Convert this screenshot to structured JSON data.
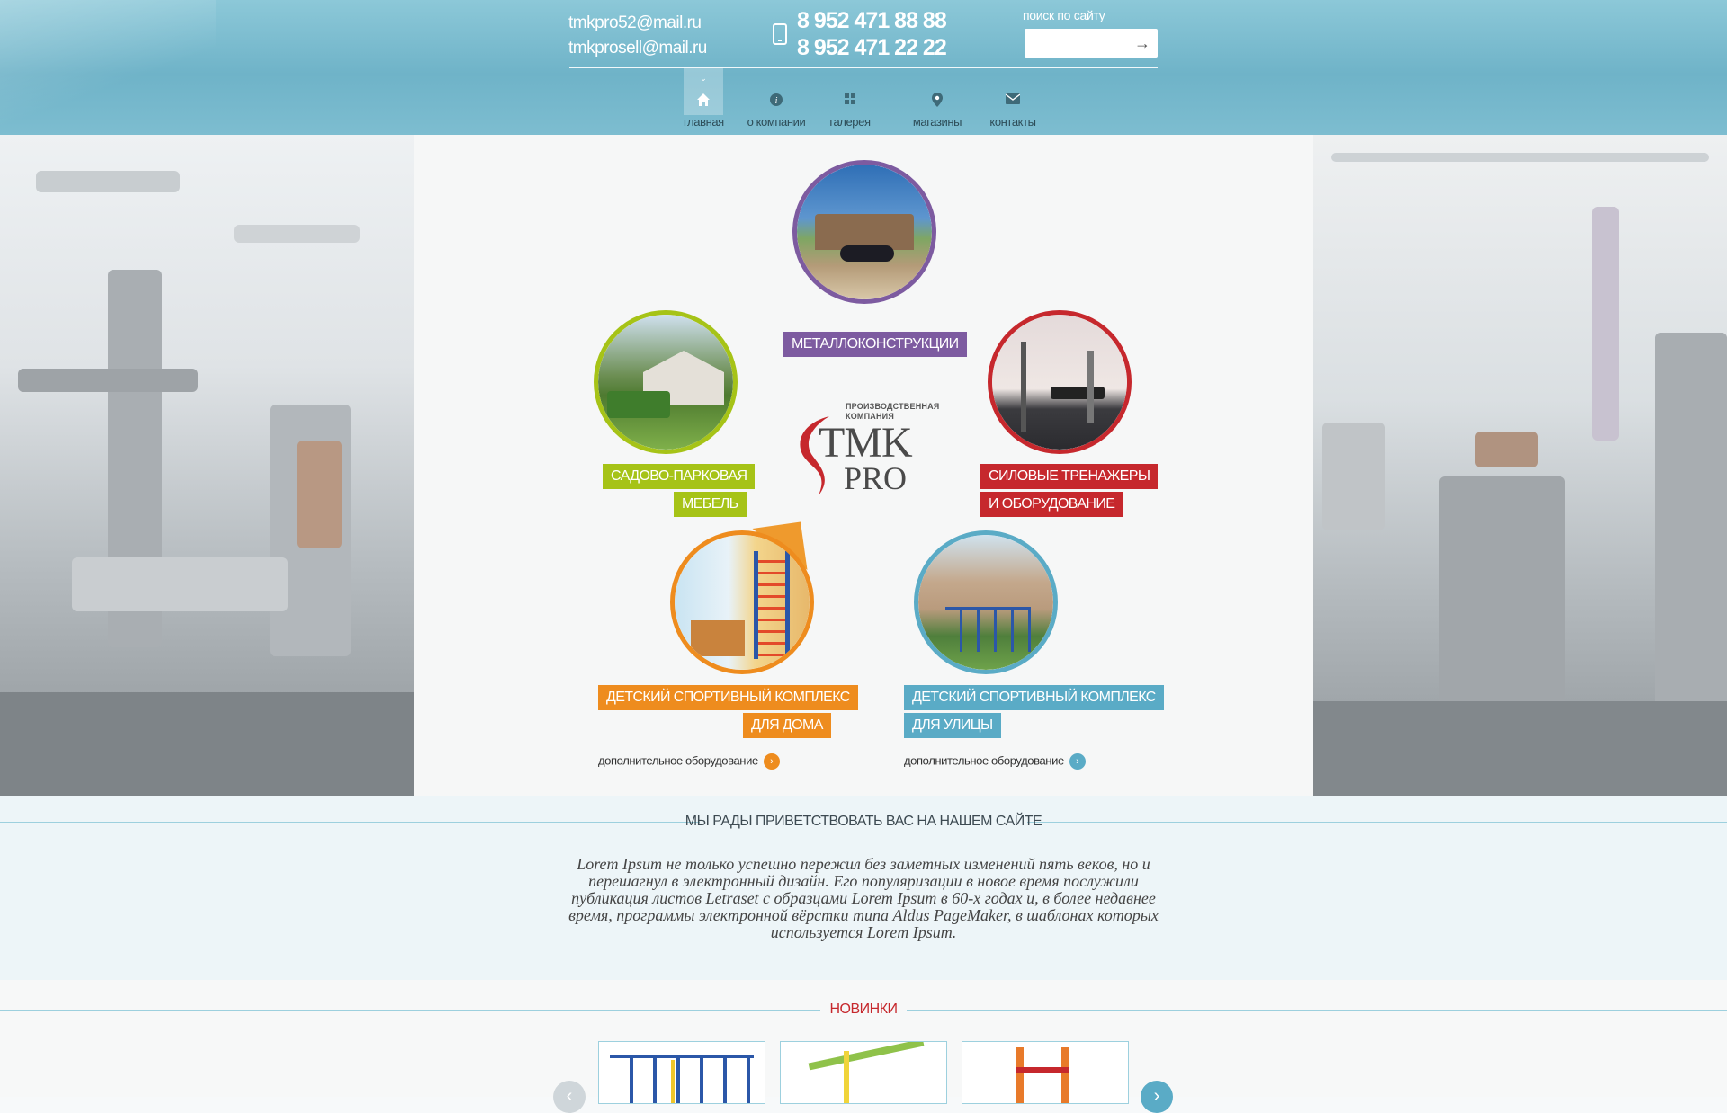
{
  "header": {
    "emails": [
      "tmkpro52@mail.ru",
      "tmkprosell@mail.ru"
    ],
    "phones": [
      "8 952 471 88 88",
      "8 952 471 22 22"
    ],
    "search": {
      "label": "поиск по сайту",
      "placeholder": ""
    }
  },
  "nav": {
    "items": [
      {
        "label": "главная",
        "icon": "home-icon",
        "active": true
      },
      {
        "label": "о компании",
        "icon": "info-icon"
      },
      {
        "label": "галерея",
        "icon": "grid-icon"
      },
      {
        "label": "магазины",
        "icon": "map-pin-icon"
      },
      {
        "label": "контакты",
        "icon": "envelope-icon"
      }
    ]
  },
  "categories": {
    "metal": {
      "label": "МЕТАЛЛОКОНСТРУКЦИИ",
      "color": "#7d5ba0"
    },
    "garden": {
      "line1": "САДОВО-ПАРКОВАЯ",
      "line2": "МЕБЕЛЬ",
      "color": "#a6c317"
    },
    "fitness": {
      "line1": "СИЛОВЫЕ ТРЕНАЖЕРЫ",
      "line2": "И ОБОРУДОВАНИЕ",
      "color": "#c6282d"
    },
    "home": {
      "line1": "ДЕТСКИЙ СПОРТИВНЫЙ КОМПЛЕКС",
      "line2": "ДЛЯ ДОМА",
      "more": "дополнительное оборудование",
      "color": "#ee8c1e"
    },
    "street": {
      "line1": "ДЕТСКИЙ СПОРТИВНЫЙ КОМПЛЕКС",
      "line2": "ДЛЯ УЛИЦЫ",
      "more": "дополнительное оборудование",
      "color": "#5aabc6"
    }
  },
  "logo": {
    "small1": "ПРОИЗВОДСТВЕННАЯ",
    "small2": "КОМПАНИЯ",
    "name": "TMK",
    "suffix": "PRO"
  },
  "welcome": {
    "title": "МЫ РАДЫ ПРИВЕТСТВОВАТЬ ВАС НА НАШЕМ САЙТЕ",
    "text": "Lorem Ipsum не только успешно пережил без заметных изменений пять веков, но и перешагнул в электронный дизайн. Его популяризации в новое время послужили публикация листов Letraset с образцами Lorem Ipsum в 60-х годах и, в более недавнее время, программы электронной вёрстки типа Aldus PageMaker, в шаблонах которых используется Lorem Ipsum."
  },
  "news": {
    "title": "НОВИНКИ",
    "title_color": "#c6282d"
  }
}
